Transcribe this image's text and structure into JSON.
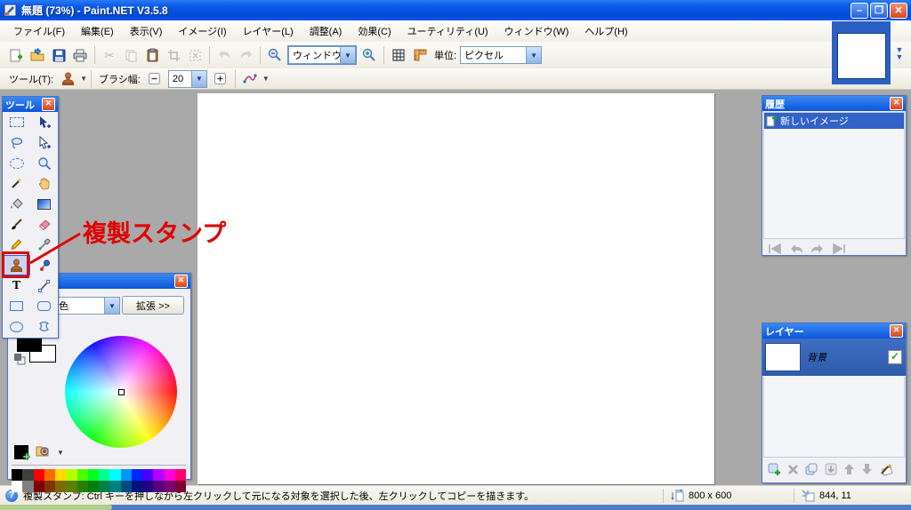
{
  "window": {
    "title": "無題 (73%) - Paint.NET V3.5.8",
    "minimize_glyph": "–",
    "restore_glyph": "❐",
    "close_glyph": "✕"
  },
  "menu": {
    "items": [
      "ファイル(F)",
      "編集(E)",
      "表示(V)",
      "イメージ(I)",
      "レイヤー(L)",
      "調整(A)",
      "効果(C)",
      "ユーティリティ(U)",
      "ウィンドウ(W)",
      "ヘルプ(H)"
    ]
  },
  "toolbar": {
    "zoom_dropdown_value": "ウィンドウ",
    "unit_label": "単位:",
    "unit_value": "ピクセル",
    "tool_label": "ツール(T):",
    "brush_width_label": "ブラシ幅:",
    "brush_width_value": "20",
    "cut_glyph": "✂"
  },
  "annotation": {
    "text": "複製スタンプ",
    "color": "#e00000"
  },
  "palettes": {
    "tools": {
      "title": "ツール",
      "close_glyph": "✕"
    },
    "colors": {
      "dropdown_value": "色",
      "expand_button": "拡張 >>",
      "close_glyph": "✕",
      "swatches_row1": [
        "#000000",
        "#404040",
        "#FF0000",
        "#FF6A00",
        "#FFD800",
        "#B6FF00",
        "#4CFF00",
        "#00FF21",
        "#00FF90",
        "#00FFFF",
        "#0094FF",
        "#0026FF",
        "#4800FF",
        "#B200FF",
        "#FF00DC",
        "#FF006E"
      ],
      "swatches_row2": [
        "#FFFFFF",
        "#808080",
        "#7F0000",
        "#7F3300",
        "#7F6A00",
        "#5B7F00",
        "#267F00",
        "#007F0E",
        "#007F46",
        "#007F7F",
        "#004A7F",
        "#00137F",
        "#21007F",
        "#57007F",
        "#7F006E",
        "#7F0037"
      ]
    },
    "history": {
      "title": "履歴",
      "close_glyph": "✕",
      "items": [
        {
          "label": "新しいイメージ"
        }
      ]
    },
    "layers": {
      "title": "レイヤー",
      "close_glyph": "✕",
      "layers": [
        {
          "name": "背景",
          "visible": true,
          "check_glyph": "✓"
        }
      ]
    }
  },
  "status_bar": {
    "help_text": "複製スタンプ: Ctrl キーを押しながら左クリックして元になる対象を選択した後、左クリックしてコピーを描きます。",
    "canvas_size": "800 x 600",
    "cursor_position": "844, 11"
  },
  "colors_theme": {
    "titlebar_blue": "#0b55dd",
    "selection_blue": "#3163c6",
    "annotation_red": "#e00000",
    "workspace_gray": "#a9a9a9"
  }
}
